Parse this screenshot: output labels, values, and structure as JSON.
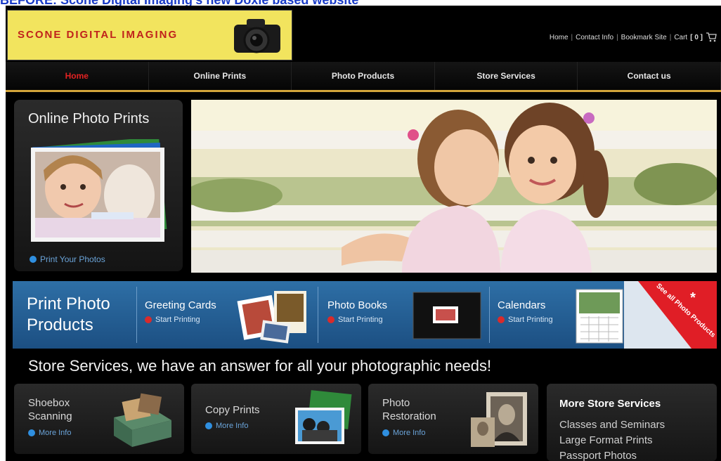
{
  "caption": "BEFORE: Scone Digital Imaging's new Doxie based website",
  "header": {
    "logo_text": "SCONE DIGITAL IMAGING",
    "top_links": [
      "Home",
      "Contact Info",
      "Bookmark Site",
      "Cart"
    ],
    "cart_count": "[ 0 ]"
  },
  "nav": {
    "items": [
      "Home",
      "Online Prints",
      "Photo Products",
      "Store Services",
      "Contact us"
    ],
    "active_index": 0
  },
  "online_prints": {
    "title": "Online Photo Prints",
    "link": "Print Your Photos"
  },
  "products_band": {
    "title": "Print Photo Products",
    "items": [
      {
        "name": "Greeting Cards",
        "link": "Start Printing"
      },
      {
        "name": "Photo Books",
        "link": "Start Printing"
      },
      {
        "name": "Calendars",
        "link": "Start Printing"
      }
    ],
    "see_all": "See all Photo Products"
  },
  "services": {
    "heading": "Store Services, we have an answer for all your photographic needs!",
    "cards": [
      {
        "title": "Shoebox Scanning",
        "link": "More Info"
      },
      {
        "title": "Copy Prints",
        "link": "More Info"
      },
      {
        "title": "Photo Restoration",
        "link": "More Info"
      }
    ],
    "more": {
      "title": "More Store Services",
      "items": [
        "Classes and Seminars",
        "Large Format Prints",
        "Passport Photos"
      ]
    }
  },
  "colors": {
    "nav_active": "#e32222",
    "accent_gold": "#d2a43a",
    "band_blue": "#1c4f82",
    "link_blue": "#6aa3d8",
    "logo_yellow": "#f2e45e"
  }
}
